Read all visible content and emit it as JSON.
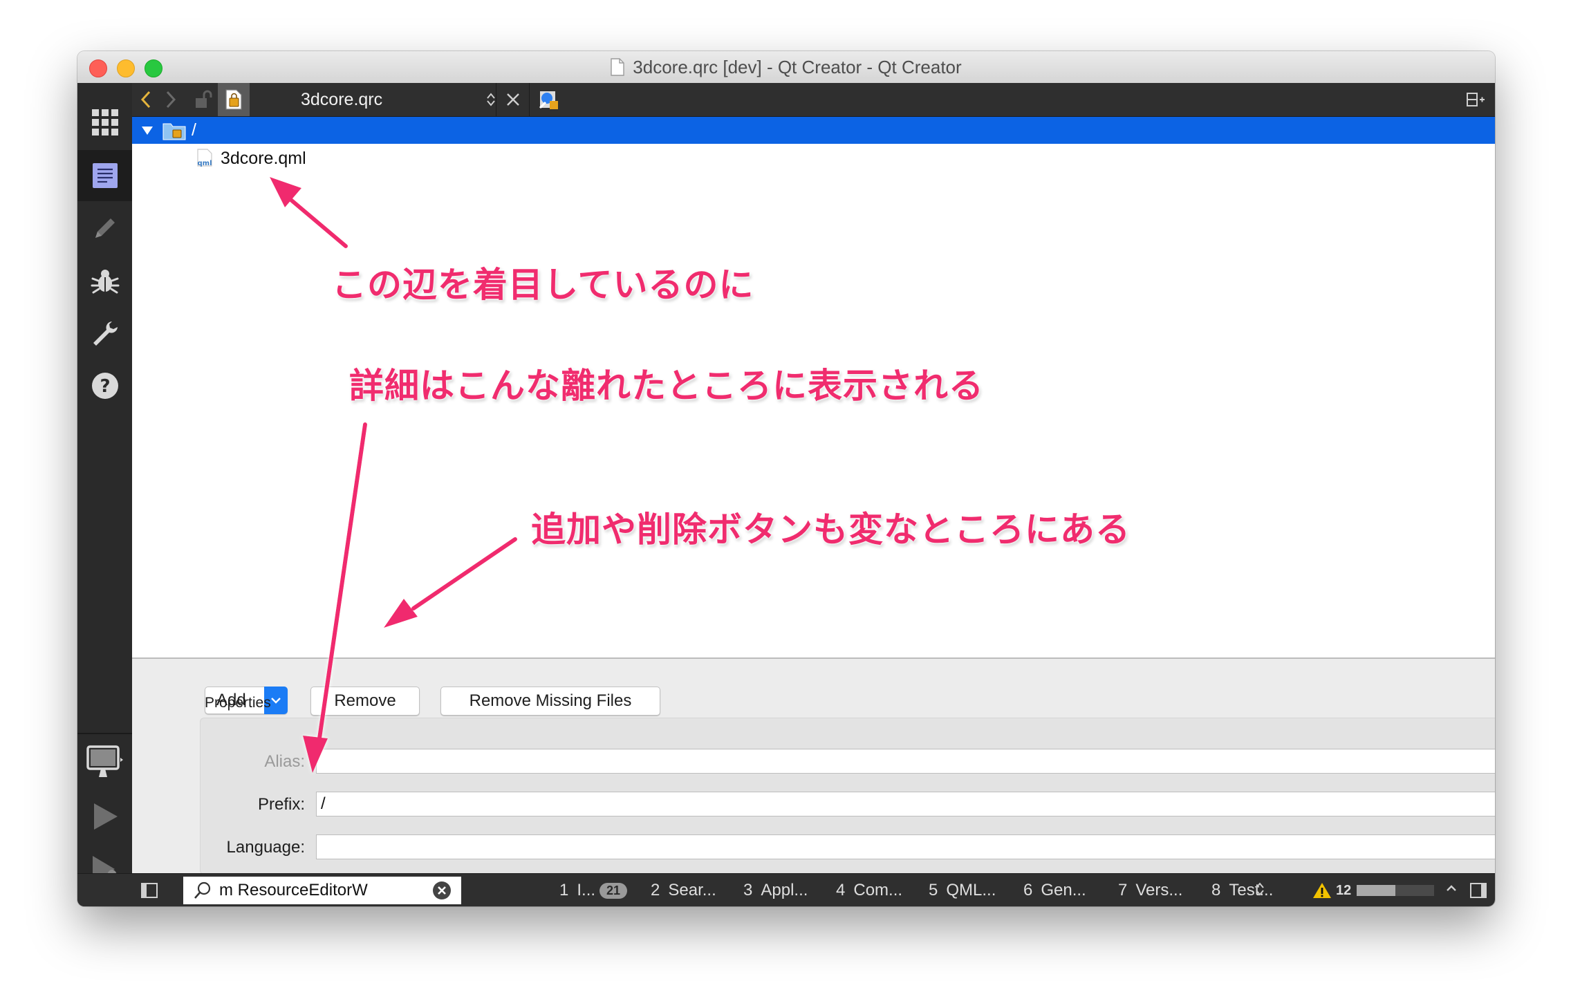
{
  "window": {
    "title": "3dcore.qrc [dev] - Qt Creator - Qt Creator"
  },
  "toolbar": {
    "document_name": "3dcore.qrc"
  },
  "tree": {
    "prefix_label": "/",
    "file_label": "3dcore.qml",
    "file_type_icon_text": "qml"
  },
  "actions": {
    "add_label": "Add",
    "remove_label": "Remove",
    "remove_missing_label": "Remove Missing Files"
  },
  "properties": {
    "group_title": "Properties",
    "alias_label": "Alias:",
    "alias_value": "",
    "prefix_label": "Prefix:",
    "prefix_value": "/",
    "language_label": "Language:",
    "language_value": ""
  },
  "statusbar": {
    "locator_value": "m ResourceEditorW",
    "output_tabs": [
      {
        "num": "1",
        "label": "I...",
        "badge": "21"
      },
      {
        "num": "2",
        "label": "Sear..."
      },
      {
        "num": "3",
        "label": "Appl..."
      },
      {
        "num": "4",
        "label": "Com..."
      },
      {
        "num": "5",
        "label": "QML..."
      },
      {
        "num": "6",
        "label": "Gen..."
      },
      {
        "num": "7",
        "label": "Vers..."
      },
      {
        "num": "8",
        "label": "Test..."
      }
    ],
    "warning_count": "12",
    "progress": 0.5
  },
  "annotations": {
    "focus_text": "この辺を着目しているのに",
    "details_text": "詳細はこんな離れたところに表示される",
    "buttons_text": "追加や削除ボタンも変なところにある"
  },
  "colors": {
    "annotation": "#f02c6e",
    "selection": "#0c63e4",
    "sidebar": "#2a2a2a"
  }
}
